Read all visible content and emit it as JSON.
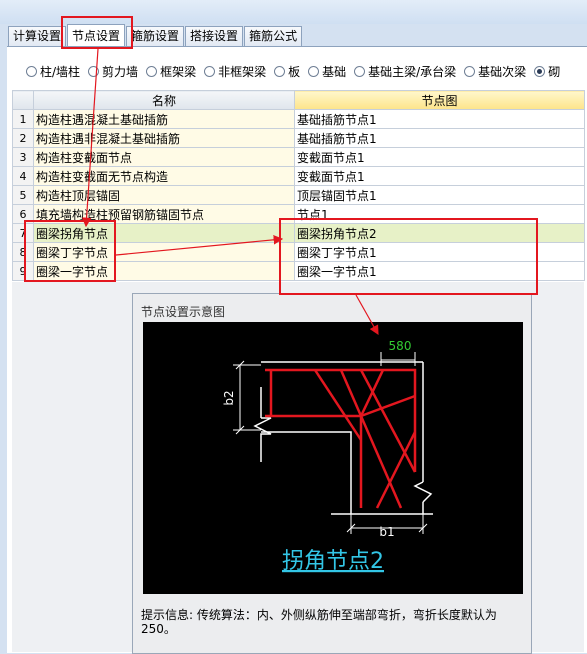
{
  "tabs": [
    "计算设置",
    "节点设置",
    "箍筋设置",
    "搭接设置",
    "箍筋公式"
  ],
  "radios": [
    "柱/墙柱",
    "剪力墙",
    "框架梁",
    "非框架梁",
    "板",
    "基础",
    "基础主梁/承台梁",
    "基础次梁",
    "砌"
  ],
  "selected_radio": 8,
  "table": {
    "headers": [
      "名称",
      "节点图"
    ],
    "rows": [
      {
        "num": "1",
        "name": "构造柱遇混凝土基础插筋",
        "node": "基础插筋节点1"
      },
      {
        "num": "2",
        "name": "构造柱遇非混凝土基础插筋",
        "node": "基础插筋节点1"
      },
      {
        "num": "3",
        "name": "构造柱变截面节点",
        "node": "变截面节点1"
      },
      {
        "num": "4",
        "name": "构造柱变截面无节点构造",
        "node": "变截面节点1"
      },
      {
        "num": "5",
        "name": "构造柱顶层锚固",
        "node": "顶层锚固节点1"
      },
      {
        "num": "6",
        "name": "填充墙构造柱预留钢筋锚固节点",
        "node": "节点1"
      },
      {
        "num": "7",
        "name": "圈梁拐角节点",
        "node": "圈梁拐角节点2"
      },
      {
        "num": "8",
        "name": "圈梁丁字节点",
        "node": "圈梁丁字节点1"
      },
      {
        "num": "9",
        "name": "圈梁一字节点",
        "node": "圈梁一字节点1"
      }
    ],
    "selected_row": 6
  },
  "preview": {
    "title": "节点设置示意图",
    "dim_top": "580",
    "dim_left": "b2",
    "dim_bottom": "b1",
    "caption": "拐角节点2"
  },
  "tip": {
    "label": "提示信息:",
    "text": "传统算法：内、外侧纵筋伸至端部弯折，弯折长度默认为250。"
  },
  "colors": {
    "annotation": "#e3171f",
    "rebar": "#e3171f",
    "dimension": "#33cc33",
    "caption": "#33c6e6"
  }
}
